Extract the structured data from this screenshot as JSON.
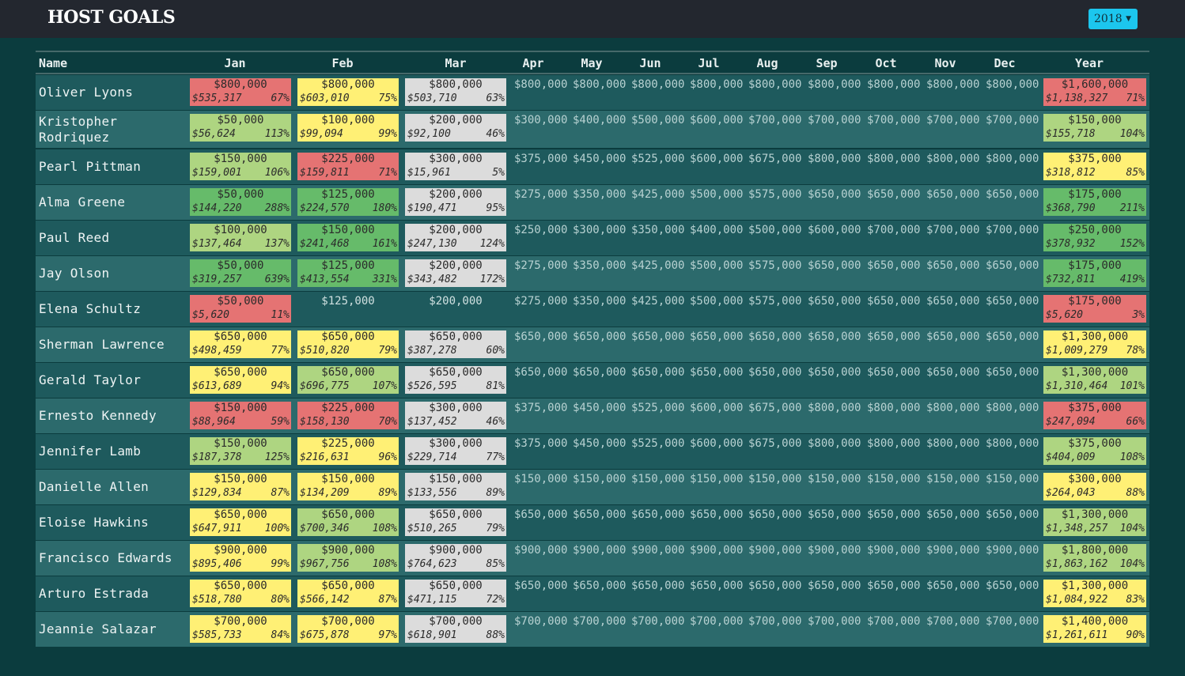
{
  "app": {
    "title": "HOST GOALS",
    "year": "2018"
  },
  "columns": [
    "Name",
    "Jan",
    "Feb",
    "Mar",
    "Apr",
    "May",
    "Jun",
    "Jul",
    "Aug",
    "Sep",
    "Oct",
    "Nov",
    "Dec",
    "Year"
  ],
  "colors": {
    "red": "#e57373",
    "yellow": "#fff075",
    "lime": "#aed581",
    "green": "#66bb6a",
    "gray": "#dcdcdc",
    "header": "#23272f",
    "background": "#0b3c3e",
    "accent": "#1cc6ee"
  },
  "rows": [
    {
      "name": "Oliver Lyons",
      "cells": [
        {
          "goal": "$800,000",
          "actual": "$535,317",
          "pct": "67%",
          "color": "red"
        },
        {
          "goal": "$800,000",
          "actual": "$603,010",
          "pct": "75%",
          "color": "yellow"
        },
        {
          "goal": "$800,000",
          "actual": "$503,710",
          "pct": "63%",
          "color": "gray"
        }
      ],
      "months": [
        "$800,000",
        "$800,000",
        "$800,000",
        "$800,000",
        "$800,000",
        "$800,000",
        "$800,000",
        "$800,000",
        "$800,000"
      ],
      "year": {
        "goal": "$1,600,000",
        "actual": "$1,138,327",
        "pct": "71%",
        "color": "red"
      }
    },
    {
      "name": "Kristopher Rodriquez",
      "cells": [
        {
          "goal": "$50,000",
          "actual": "$56,624",
          "pct": "113%",
          "color": "lime"
        },
        {
          "goal": "$100,000",
          "actual": "$99,094",
          "pct": "99%",
          "color": "yellow"
        },
        {
          "goal": "$200,000",
          "actual": "$92,100",
          "pct": "46%",
          "color": "gray"
        }
      ],
      "months": [
        "$300,000",
        "$400,000",
        "$500,000",
        "$600,000",
        "$700,000",
        "$700,000",
        "$700,000",
        "$700,000",
        "$700,000"
      ],
      "year": {
        "goal": "$150,000",
        "actual": "$155,718",
        "pct": "104%",
        "color": "lime"
      }
    },
    {
      "name": "Pearl Pittman",
      "cells": [
        {
          "goal": "$150,000",
          "actual": "$159,001",
          "pct": "106%",
          "color": "lime"
        },
        {
          "goal": "$225,000",
          "actual": "$159,811",
          "pct": "71%",
          "color": "red"
        },
        {
          "goal": "$300,000",
          "actual": "$15,961",
          "pct": "5%",
          "color": "gray"
        }
      ],
      "months": [
        "$375,000",
        "$450,000",
        "$525,000",
        "$600,000",
        "$675,000",
        "$800,000",
        "$800,000",
        "$800,000",
        "$800,000"
      ],
      "year": {
        "goal": "$375,000",
        "actual": "$318,812",
        "pct": "85%",
        "color": "yellow"
      }
    },
    {
      "name": "Alma Greene",
      "cells": [
        {
          "goal": "$50,000",
          "actual": "$144,220",
          "pct": "288%",
          "color": "green"
        },
        {
          "goal": "$125,000",
          "actual": "$224,570",
          "pct": "180%",
          "color": "green"
        },
        {
          "goal": "$200,000",
          "actual": "$190,471",
          "pct": "95%",
          "color": "gray"
        }
      ],
      "months": [
        "$275,000",
        "$350,000",
        "$425,000",
        "$500,000",
        "$575,000",
        "$650,000",
        "$650,000",
        "$650,000",
        "$650,000"
      ],
      "year": {
        "goal": "$175,000",
        "actual": "$368,790",
        "pct": "211%",
        "color": "green"
      }
    },
    {
      "name": "Paul Reed",
      "cells": [
        {
          "goal": "$100,000",
          "actual": "$137,464",
          "pct": "137%",
          "color": "lime"
        },
        {
          "goal": "$150,000",
          "actual": "$241,468",
          "pct": "161%",
          "color": "green"
        },
        {
          "goal": "$200,000",
          "actual": "$247,130",
          "pct": "124%",
          "color": "gray"
        }
      ],
      "months": [
        "$250,000",
        "$300,000",
        "$350,000",
        "$400,000",
        "$500,000",
        "$600,000",
        "$700,000",
        "$700,000",
        "$700,000"
      ],
      "year": {
        "goal": "$250,000",
        "actual": "$378,932",
        "pct": "152%",
        "color": "green"
      }
    },
    {
      "name": "Jay Olson",
      "cells": [
        {
          "goal": "$50,000",
          "actual": "$319,257",
          "pct": "639%",
          "color": "green"
        },
        {
          "goal": "$125,000",
          "actual": "$413,554",
          "pct": "331%",
          "color": "green"
        },
        {
          "goal": "$200,000",
          "actual": "$343,482",
          "pct": "172%",
          "color": "gray"
        }
      ],
      "months": [
        "$275,000",
        "$350,000",
        "$425,000",
        "$500,000",
        "$575,000",
        "$650,000",
        "$650,000",
        "$650,000",
        "$650,000"
      ],
      "year": {
        "goal": "$175,000",
        "actual": "$732,811",
        "pct": "419%",
        "color": "green"
      }
    },
    {
      "name": "Elena Schultz",
      "cells": [
        {
          "goal": "$50,000",
          "actual": "$5,620",
          "pct": "11%",
          "color": "red"
        },
        {
          "goal": "$125,000",
          "actual": "",
          "pct": "",
          "color": "none"
        },
        {
          "goal": "$200,000",
          "actual": "",
          "pct": "",
          "color": "none"
        }
      ],
      "months": [
        "$275,000",
        "$350,000",
        "$425,000",
        "$500,000",
        "$575,000",
        "$650,000",
        "$650,000",
        "$650,000",
        "$650,000"
      ],
      "year": {
        "goal": "$175,000",
        "actual": "$5,620",
        "pct": "3%",
        "color": "red"
      }
    },
    {
      "name": "Sherman Lawrence",
      "cells": [
        {
          "goal": "$650,000",
          "actual": "$498,459",
          "pct": "77%",
          "color": "yellow"
        },
        {
          "goal": "$650,000",
          "actual": "$510,820",
          "pct": "79%",
          "color": "yellow"
        },
        {
          "goal": "$650,000",
          "actual": "$387,278",
          "pct": "60%",
          "color": "gray"
        }
      ],
      "months": [
        "$650,000",
        "$650,000",
        "$650,000",
        "$650,000",
        "$650,000",
        "$650,000",
        "$650,000",
        "$650,000",
        "$650,000"
      ],
      "year": {
        "goal": "$1,300,000",
        "actual": "$1,009,279",
        "pct": "78%",
        "color": "yellow"
      }
    },
    {
      "name": "Gerald Taylor",
      "cells": [
        {
          "goal": "$650,000",
          "actual": "$613,689",
          "pct": "94%",
          "color": "yellow"
        },
        {
          "goal": "$650,000",
          "actual": "$696,775",
          "pct": "107%",
          "color": "lime"
        },
        {
          "goal": "$650,000",
          "actual": "$526,595",
          "pct": "81%",
          "color": "gray"
        }
      ],
      "months": [
        "$650,000",
        "$650,000",
        "$650,000",
        "$650,000",
        "$650,000",
        "$650,000",
        "$650,000",
        "$650,000",
        "$650,000"
      ],
      "year": {
        "goal": "$1,300,000",
        "actual": "$1,310,464",
        "pct": "101%",
        "color": "lime"
      }
    },
    {
      "name": "Ernesto Kennedy",
      "cells": [
        {
          "goal": "$150,000",
          "actual": "$88,964",
          "pct": "59%",
          "color": "red"
        },
        {
          "goal": "$225,000",
          "actual": "$158,130",
          "pct": "70%",
          "color": "red"
        },
        {
          "goal": "$300,000",
          "actual": "$137,452",
          "pct": "46%",
          "color": "gray"
        }
      ],
      "months": [
        "$375,000",
        "$450,000",
        "$525,000",
        "$600,000",
        "$675,000",
        "$800,000",
        "$800,000",
        "$800,000",
        "$800,000"
      ],
      "year": {
        "goal": "$375,000",
        "actual": "$247,094",
        "pct": "66%",
        "color": "red"
      }
    },
    {
      "name": "Jennifer Lamb",
      "cells": [
        {
          "goal": "$150,000",
          "actual": "$187,378",
          "pct": "125%",
          "color": "lime"
        },
        {
          "goal": "$225,000",
          "actual": "$216,631",
          "pct": "96%",
          "color": "yellow"
        },
        {
          "goal": "$300,000",
          "actual": "$229,714",
          "pct": "77%",
          "color": "gray"
        }
      ],
      "months": [
        "$375,000",
        "$450,000",
        "$525,000",
        "$600,000",
        "$675,000",
        "$800,000",
        "$800,000",
        "$800,000",
        "$800,000"
      ],
      "year": {
        "goal": "$375,000",
        "actual": "$404,009",
        "pct": "108%",
        "color": "lime"
      }
    },
    {
      "name": "Danielle Allen",
      "cells": [
        {
          "goal": "$150,000",
          "actual": "$129,834",
          "pct": "87%",
          "color": "yellow"
        },
        {
          "goal": "$150,000",
          "actual": "$134,209",
          "pct": "89%",
          "color": "yellow"
        },
        {
          "goal": "$150,000",
          "actual": "$133,556",
          "pct": "89%",
          "color": "gray"
        }
      ],
      "months": [
        "$150,000",
        "$150,000",
        "$150,000",
        "$150,000",
        "$150,000",
        "$150,000",
        "$150,000",
        "$150,000",
        "$150,000"
      ],
      "year": {
        "goal": "$300,000",
        "actual": "$264,043",
        "pct": "88%",
        "color": "yellow"
      }
    },
    {
      "name": "Eloise Hawkins",
      "cells": [
        {
          "goal": "$650,000",
          "actual": "$647,911",
          "pct": "100%",
          "color": "yellow"
        },
        {
          "goal": "$650,000",
          "actual": "$700,346",
          "pct": "108%",
          "color": "lime"
        },
        {
          "goal": "$650,000",
          "actual": "$510,265",
          "pct": "79%",
          "color": "gray"
        }
      ],
      "months": [
        "$650,000",
        "$650,000",
        "$650,000",
        "$650,000",
        "$650,000",
        "$650,000",
        "$650,000",
        "$650,000",
        "$650,000"
      ],
      "year": {
        "goal": "$1,300,000",
        "actual": "$1,348,257",
        "pct": "104%",
        "color": "lime"
      }
    },
    {
      "name": "Francisco Edwards",
      "cells": [
        {
          "goal": "$900,000",
          "actual": "$895,406",
          "pct": "99%",
          "color": "yellow"
        },
        {
          "goal": "$900,000",
          "actual": "$967,756",
          "pct": "108%",
          "color": "lime"
        },
        {
          "goal": "$900,000",
          "actual": "$764,623",
          "pct": "85%",
          "color": "gray"
        }
      ],
      "months": [
        "$900,000",
        "$900,000",
        "$900,000",
        "$900,000",
        "$900,000",
        "$900,000",
        "$900,000",
        "$900,000",
        "$900,000"
      ],
      "year": {
        "goal": "$1,800,000",
        "actual": "$1,863,162",
        "pct": "104%",
        "color": "lime"
      }
    },
    {
      "name": "Arturo Estrada",
      "cells": [
        {
          "goal": "$650,000",
          "actual": "$518,780",
          "pct": "80%",
          "color": "yellow"
        },
        {
          "goal": "$650,000",
          "actual": "$566,142",
          "pct": "87%",
          "color": "yellow"
        },
        {
          "goal": "$650,000",
          "actual": "$471,115",
          "pct": "72%",
          "color": "gray"
        }
      ],
      "months": [
        "$650,000",
        "$650,000",
        "$650,000",
        "$650,000",
        "$650,000",
        "$650,000",
        "$650,000",
        "$650,000",
        "$650,000"
      ],
      "year": {
        "goal": "$1,300,000",
        "actual": "$1,084,922",
        "pct": "83%",
        "color": "yellow"
      }
    },
    {
      "name": "Jeannie Salazar",
      "cells": [
        {
          "goal": "$700,000",
          "actual": "$585,733",
          "pct": "84%",
          "color": "yellow"
        },
        {
          "goal": "$700,000",
          "actual": "$675,878",
          "pct": "97%",
          "color": "yellow"
        },
        {
          "goal": "$700,000",
          "actual": "$618,901",
          "pct": "88%",
          "color": "gray"
        }
      ],
      "months": [
        "$700,000",
        "$700,000",
        "$700,000",
        "$700,000",
        "$700,000",
        "$700,000",
        "$700,000",
        "$700,000",
        "$700,000"
      ],
      "year": {
        "goal": "$1,400,000",
        "actual": "$1,261,611",
        "pct": "90%",
        "color": "yellow"
      }
    }
  ]
}
